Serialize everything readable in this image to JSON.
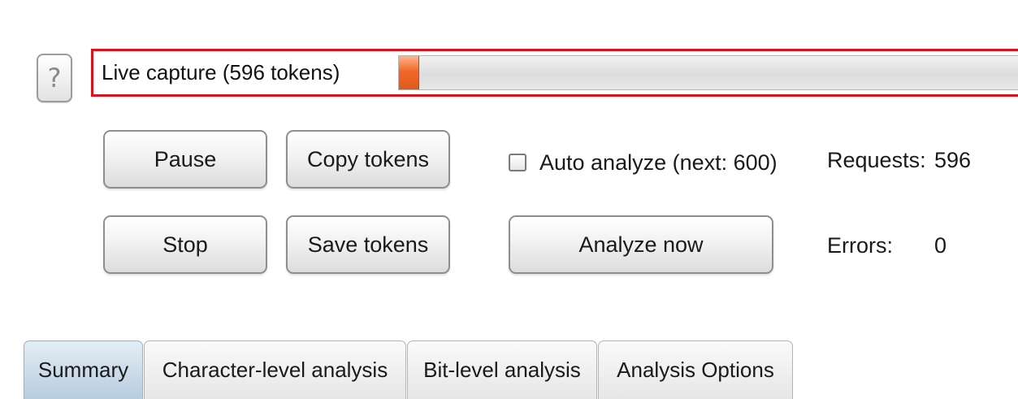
{
  "help": {
    "icon": "question-mark-icon",
    "glyph": "?"
  },
  "capture": {
    "label": "Live capture (596 tokens)",
    "progress_fraction": 0.03,
    "accent_color": "#e0111e",
    "fill_color": "#f0692a"
  },
  "controls": {
    "pause_label": "Pause",
    "copy_tokens_label": "Copy tokens",
    "stop_label": "Stop",
    "save_tokens_label": "Save tokens",
    "analyze_now_label": "Analyze now",
    "auto_analyze_label": "Auto analyze (next: 600)",
    "auto_analyze_checked": false
  },
  "stats": {
    "requests_label": "Requests:",
    "requests_value": "596",
    "errors_label": "Errors:",
    "errors_value": "0"
  },
  "tabs": [
    {
      "label": "Summary",
      "active": true
    },
    {
      "label": "Character-level analysis",
      "active": false
    },
    {
      "label": "Bit-level analysis",
      "active": false
    },
    {
      "label": "Analysis Options",
      "active": false
    }
  ]
}
